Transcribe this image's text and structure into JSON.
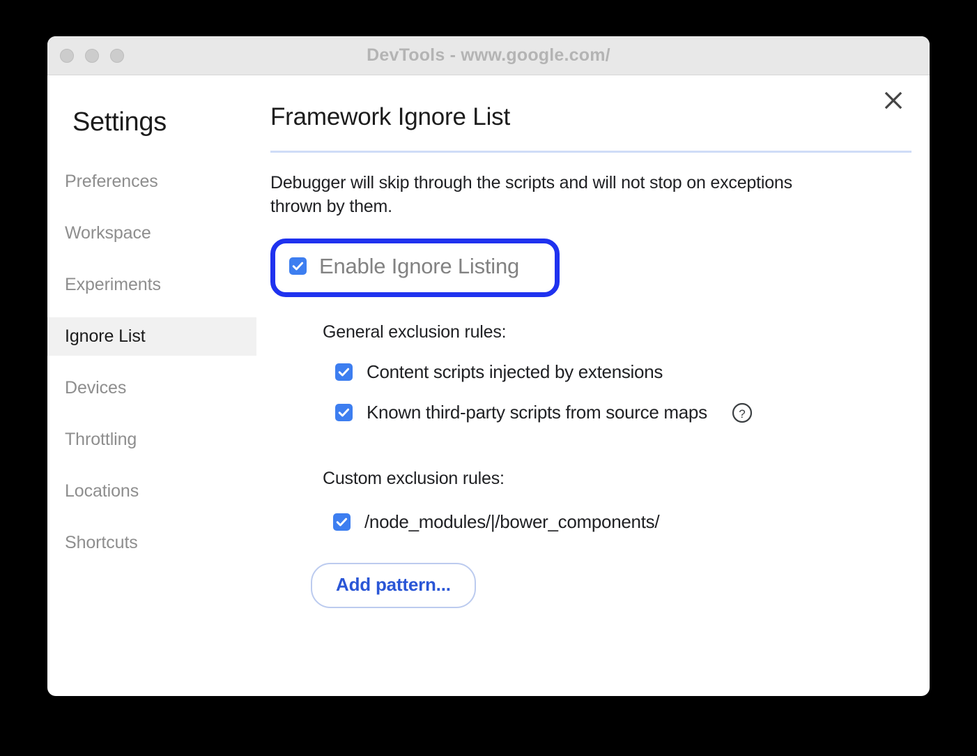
{
  "window": {
    "title": "DevTools - www.google.com/",
    "traffic_lights": [
      "close",
      "minimize",
      "zoom"
    ]
  },
  "sidebar": {
    "heading": "Settings",
    "items": [
      {
        "label": "Preferences",
        "selected": false
      },
      {
        "label": "Workspace",
        "selected": false
      },
      {
        "label": "Experiments",
        "selected": false
      },
      {
        "label": "Ignore List",
        "selected": true
      },
      {
        "label": "Devices",
        "selected": false
      },
      {
        "label": "Throttling",
        "selected": false
      },
      {
        "label": "Locations",
        "selected": false
      },
      {
        "label": "Shortcuts",
        "selected": false
      }
    ]
  },
  "panel": {
    "title": "Framework Ignore List",
    "close_label": "×",
    "description": "Debugger will skip through the scripts and will not stop on exceptions thrown by them.",
    "enable": {
      "label": "Enable Ignore Listing",
      "checked": true,
      "highlighted": true
    },
    "general_section": {
      "label": "General exclusion rules:",
      "rules": [
        {
          "label": "Content scripts injected by extensions",
          "checked": true,
          "help": false
        },
        {
          "label": "Known third-party scripts from source maps",
          "checked": true,
          "help": true
        }
      ]
    },
    "custom_section": {
      "label": "Custom exclusion rules:",
      "rules": [
        {
          "label": "/node_modules/|/bower_components/",
          "checked": true
        }
      ]
    },
    "add_pattern_label": "Add pattern..."
  },
  "colors": {
    "page_background": "#000000",
    "window_background": "#ffffff",
    "titlebar": "#e8e8e8",
    "title_text": "#b4b4b4",
    "sidebar_selected": "#f1f1f1",
    "checkbox_blue": "#3d7ef0",
    "highlight_blue": "#1f32ef",
    "divider_blue": "#cfdcf7",
    "button_text_blue": "#2a56d6",
    "button_border_blue": "#bccbef",
    "muted_text": "#8e8e8e"
  }
}
